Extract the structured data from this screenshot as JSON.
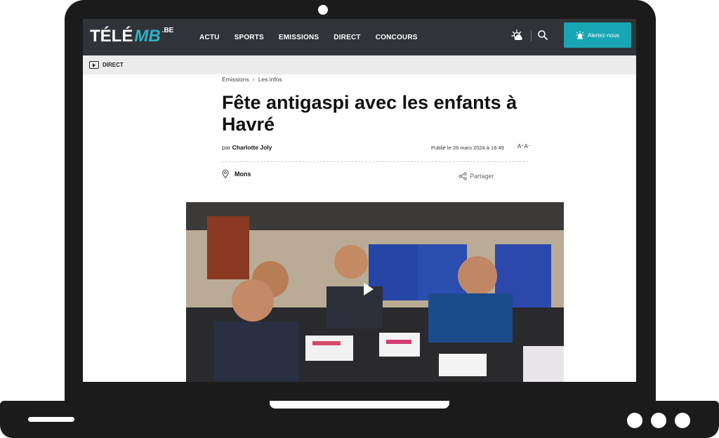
{
  "site": {
    "logo_tele": "TÉLÉ",
    "logo_mb": "MB",
    "logo_be": ".BE"
  },
  "nav": {
    "items": [
      {
        "label": "ACTU"
      },
      {
        "label": "SPORTS"
      },
      {
        "label": "EMISSIONS"
      },
      {
        "label": "DIRECT"
      },
      {
        "label": "CONCOURS"
      }
    ]
  },
  "header": {
    "alert_button_label": "Alertez-nous",
    "weather_icon": "weather-sun-cloud-icon",
    "search_icon": "search-icon"
  },
  "direct_bar": {
    "label": "DIRECT"
  },
  "breadcrumb": {
    "items": [
      "Emissions",
      "Les infos"
    ]
  },
  "article": {
    "title": "Fête antigaspi avec les enfants à Havré",
    "by_prefix": "par",
    "author": "Charlotte Joly",
    "published": "Publié le 26 mars 2024 à 16:49",
    "font_size_control": "A⁺A⁻",
    "location": "Mons",
    "share_label": "Partager"
  },
  "colors": {
    "topbar": "#303337",
    "accent": "#18a6b5",
    "logo_accent": "#2fb2c5",
    "direct_bar": "#ececec"
  }
}
